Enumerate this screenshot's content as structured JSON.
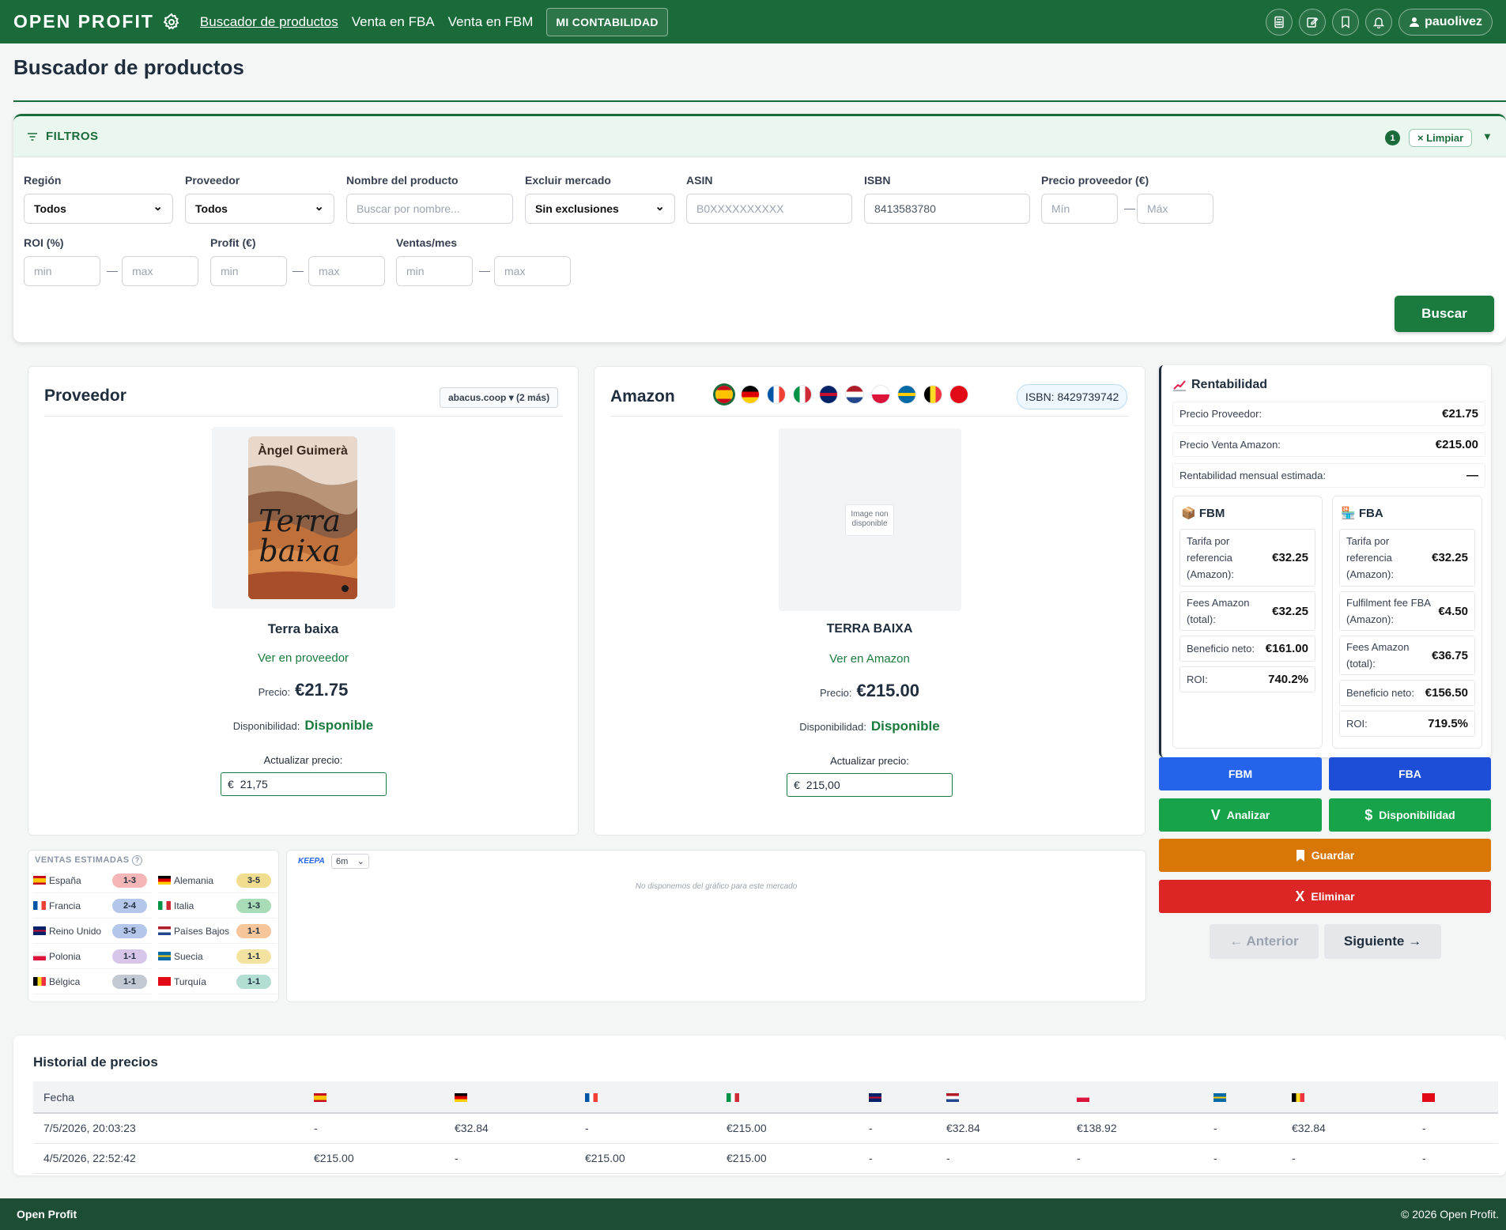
{
  "nav": {
    "logo": "OPEN PROFIT",
    "links": [
      "Buscador de productos",
      "Venta en FBA",
      "Venta en FBM"
    ],
    "contabilidad": "MI CONTABILIDAD",
    "user": "pauolivez"
  },
  "page_title": "Buscador de productos",
  "filters": {
    "title": "FILTROS",
    "count": "1",
    "clear": "× Limpiar",
    "region_label": "Región",
    "region_value": "Todos",
    "proveedor_label": "Proveedor",
    "proveedor_value": "Todos",
    "nombre_label": "Nombre del producto",
    "nombre_placeholder": "Buscar por nombre...",
    "excluir_label": "Excluir mercado",
    "excluir_value": "Sin exclusiones",
    "asin_label": "ASIN",
    "asin_placeholder": "B0XXXXXXXXXX",
    "isbn_label": "ISBN",
    "isbn_value": "8413583780",
    "precio_label": "Precio proveedor (€)",
    "precio_min": "Mín",
    "precio_max": "Máx",
    "roi_label": "ROI (%)",
    "profit_label": "Profit (€)",
    "ventas_label": "Ventas/mes",
    "min": "min",
    "max": "max",
    "dash": "—",
    "search": "Buscar"
  },
  "proveedor": {
    "title": "Proveedor",
    "selector": "abacus.coop ▾ (2 más)",
    "cover_author": "Àngel Guimerà",
    "cover_title": "Terra baixa",
    "product_name": "Terra baixa",
    "link": "Ver en proveedor",
    "precio_label": "Precio:",
    "precio": "€21.75",
    "disp_label": "Disponibilidad:",
    "disp": "Disponible",
    "update_label": "Actualizar precio:",
    "currency": "€",
    "update_value": "21,75"
  },
  "amazon": {
    "title": "Amazon",
    "isbn": "ISBN: 8429739742",
    "image_missing": "Image non disponible",
    "product_name": "TERRA BAIXA",
    "link": "Ver en Amazon",
    "precio_label": "Precio:",
    "precio": "€215.00",
    "disp_label": "Disponibilidad:",
    "disp": "Disponible",
    "update_label": "Actualizar precio:",
    "currency": "€",
    "update_value": "215,00"
  },
  "rentabilidad": {
    "title": "Rentabilidad",
    "rows": [
      {
        "label": "Precio Proveedor:",
        "value": "€21.75"
      },
      {
        "label": "Precio Venta Amazon:",
        "value": "€215.00"
      },
      {
        "label": "Rentabilidad mensual estimada:",
        "value": "—"
      }
    ],
    "fbm": {
      "title": "FBM",
      "tarifa_label": "Tarifa por referencia (Amazon):",
      "tarifa": "€32.25",
      "fees_label": "Fees Amazon (total):",
      "fees": "€32.25",
      "neto_label": "Beneficio neto:",
      "neto": "€161.00",
      "roi_label": "ROI:",
      "roi": "740.2%"
    },
    "fba": {
      "title": "FBA",
      "tarifa_label": "Tarifa por referencia (Amazon):",
      "tarifa": "€32.25",
      "fulfil_label": "Fulfilment fee FBA (Amazon):",
      "fulfil": "€4.50",
      "fees_label": "Fees Amazon (total):",
      "fees": "€36.75",
      "neto_label": "Beneficio neto:",
      "neto": "€156.50",
      "roi_label": "ROI:",
      "roi": "719.5%"
    }
  },
  "actions": {
    "fbm": "FBM",
    "fba": "FBA",
    "analizar_icon": "V",
    "analizar": "Analizar",
    "disp_icon": "$",
    "disponibilidad": "Disponibilidad",
    "guardar": "Guardar",
    "eliminar_icon": "X",
    "eliminar": "Eliminar",
    "anterior": "← Anterior",
    "siguiente": "Siguiente →"
  },
  "ventas": {
    "title": "VENTAS ESTIMADAS",
    "help": "?",
    "rows": [
      {
        "country": "España",
        "range": "1-3",
        "color": "#f4b6b6"
      },
      {
        "country": "Alemania",
        "range": "3-5",
        "color": "#f1dd8f"
      },
      {
        "country": "Francia",
        "range": "2-4",
        "color": "#b4c6ea"
      },
      {
        "country": "Italia",
        "range": "1-3",
        "color": "#a8dcb6"
      },
      {
        "country": "Reino Unido",
        "range": "3-5",
        "color": "#b4c6ea"
      },
      {
        "country": "Países Bajos",
        "range": "1-1",
        "color": "#f6c59a"
      },
      {
        "country": "Polonia",
        "range": "1-1",
        "color": "#d8c6ea"
      },
      {
        "country": "Suecia",
        "range": "1-1",
        "color": "#f4e3a0"
      },
      {
        "country": "Bélgica",
        "range": "1-1",
        "color": "#c3c9d3"
      },
      {
        "country": "Turquía",
        "range": "1-1",
        "color": "#b2ddd3"
      }
    ]
  },
  "keepa": {
    "brand": "KEEPA",
    "range": "6m",
    "empty": "No disponemos del gráfico para este mercado"
  },
  "historial": {
    "title": "Historial de precios",
    "col_fecha": "Fecha",
    "rows": [
      {
        "fecha": "7/5/2026, 20:03:23",
        "v": [
          "-",
          "€32.84",
          "-",
          "€215.00",
          "-",
          "€32.84",
          "€138.92",
          "-",
          "€32.84",
          "-"
        ]
      },
      {
        "fecha": "4/5/2026, 22:52:42",
        "v": [
          "€215.00",
          "-",
          "€215.00",
          "€215.00",
          "-",
          "-",
          "-",
          "-",
          "-",
          "-"
        ]
      }
    ]
  },
  "footer": {
    "left": "Open Profit",
    "right": "© 2026 Open Profit."
  },
  "colors": {
    "primary": "#1b6b3a",
    "fbm": "#2563eb",
    "fba": "#1d4ed8",
    "analizar": "#16a34a",
    "guardar": "#d97706",
    "eliminar": "#dc2626"
  }
}
